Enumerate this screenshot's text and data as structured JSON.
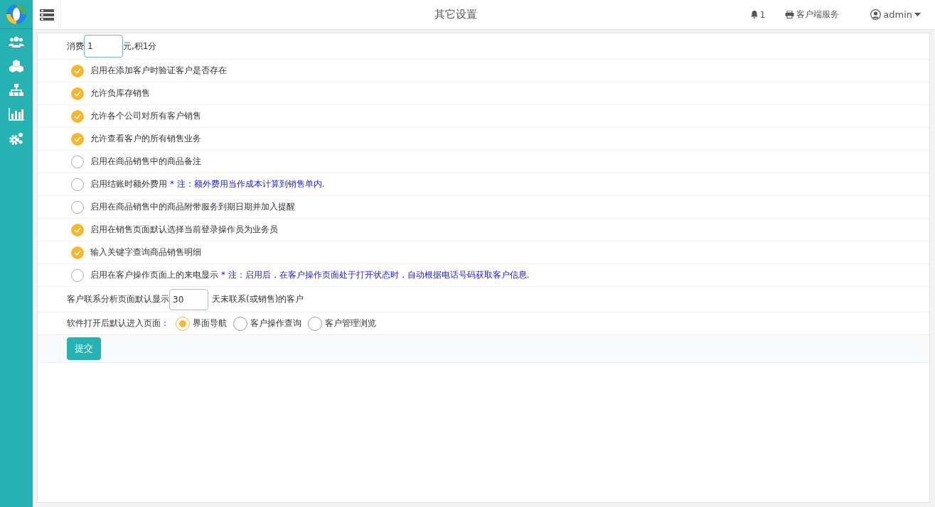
{
  "header": {
    "title": "其它设置",
    "notification_count": "1",
    "client_service": "客户端服务",
    "user": "admin"
  },
  "points": {
    "label_before": "消费",
    "value": "1",
    "label_after": "元,积1分"
  },
  "options": [
    {
      "label": "启用在添加客户时验证客户是否存在",
      "checked": true
    },
    {
      "label": "允许负库存销售",
      "checked": true
    },
    {
      "label": "允许各个公司对所有客户销售",
      "checked": true
    },
    {
      "label": "允许查看客户的所有销售业务",
      "checked": true
    },
    {
      "label": "启用在商品销售中的商品备注",
      "checked": false
    },
    {
      "label": "启用结账时额外费用",
      "note": "* 注：额外费用当作成本计算到销售单内.",
      "checked": false
    },
    {
      "label": "启用在商品销售中的商品附带服务到期日期并加入提醒",
      "checked": false
    },
    {
      "label": "启用在销售页面默认选择当前登录操作员为业务员",
      "checked": true
    },
    {
      "label": "输入关键字查询商品销售明细",
      "checked": true
    },
    {
      "label": "启用在客户操作页面上的来电显示",
      "note": "* 注：启用后，在客户操作页面处于打开状态时，自动根据电话号码获取客户信息.",
      "checked": false
    }
  ],
  "contact_days": {
    "label_before": "客户联系分析页面默认显示",
    "value": "30",
    "label_after": "天未联系(或销售)的客户"
  },
  "start_page": {
    "label": "软件打开后默认进入页面：",
    "choices": [
      {
        "label": "界面导航",
        "selected": true
      },
      {
        "label": "客户操作查询",
        "selected": false
      },
      {
        "label": "客户管理浏览",
        "selected": false
      }
    ]
  },
  "submit": "提交"
}
